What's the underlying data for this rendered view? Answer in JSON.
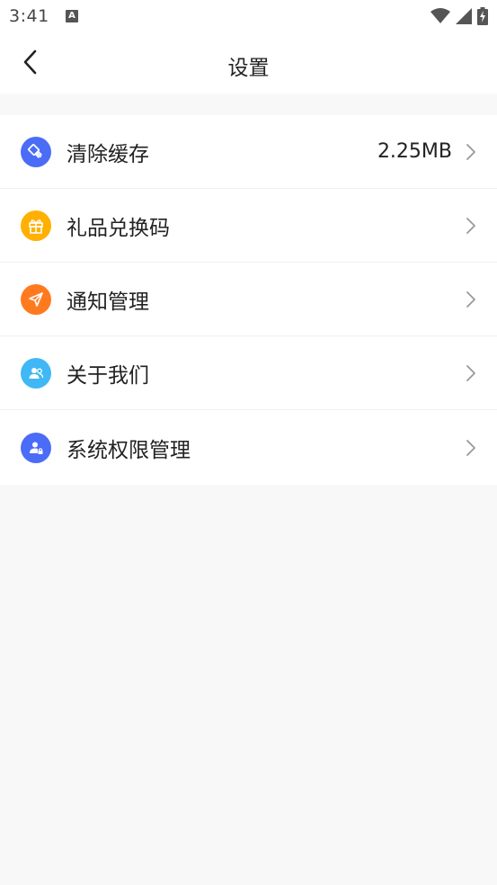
{
  "status_bar": {
    "time": "3:41",
    "notification_letter": "A",
    "icons": [
      "wifi-icon",
      "signal-icon",
      "battery-charging-icon"
    ]
  },
  "header": {
    "title": "设置",
    "back_icon": "chevron-left-icon"
  },
  "settings": {
    "items": [
      {
        "label": "清除缓存",
        "value": "2.25MB",
        "icon": "broom-icon",
        "color": "#4a6cf7"
      },
      {
        "label": "礼品兑换码",
        "value": "",
        "icon": "gift-icon",
        "color": "#ffb000"
      },
      {
        "label": "通知管理",
        "value": "",
        "icon": "paper-plane-icon",
        "color": "#ff7a1f"
      },
      {
        "label": "关于我们",
        "value": "",
        "icon": "users-icon",
        "color": "#3fb8f5"
      },
      {
        "label": "系统权限管理",
        "value": "",
        "icon": "user-lock-icon",
        "color": "#4a6cf7"
      }
    ]
  },
  "colors": {
    "background": "#f8f8f8",
    "surface": "#ffffff",
    "divider": "#f0f0f0",
    "chevron": "#999999"
  }
}
